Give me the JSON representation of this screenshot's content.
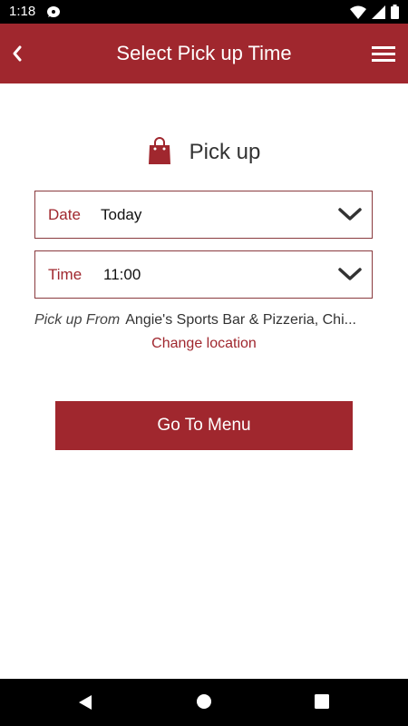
{
  "status_bar": {
    "time": "1:18",
    "icons": [
      "notification-icon",
      "wifi-icon",
      "signal-icon",
      "battery-icon"
    ]
  },
  "app_bar": {
    "title": "Select Pick up Time",
    "back_icon": "chevron-left-icon",
    "menu_icon": "hamburger-menu-icon",
    "color": "#a0272e"
  },
  "order_mode": {
    "icon": "shopping-bag-icon",
    "label": "Pick up"
  },
  "date_select": {
    "label": "Date",
    "value": "Today"
  },
  "time_select": {
    "label": "Time",
    "value": "11:00"
  },
  "pickup_from": {
    "label": "Pick up From",
    "location": "Angie's Sports Bar & Pizzeria, Chi..."
  },
  "change_location": "Change location",
  "go_button": "Go To Menu",
  "nav_bar": {
    "icons": [
      "back-triangle-icon",
      "home-circle-icon",
      "recents-square-icon"
    ]
  }
}
